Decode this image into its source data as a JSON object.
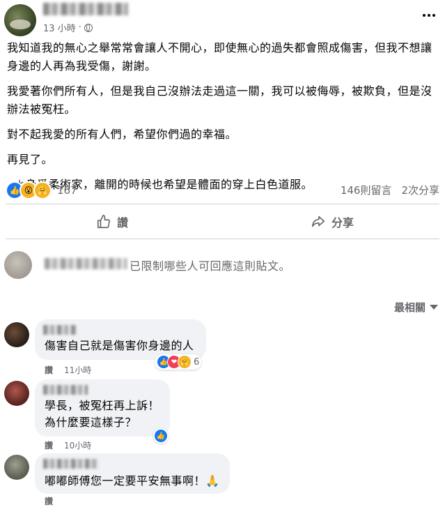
{
  "header": {
    "time": "13 小時",
    "dot": "·",
    "more_icon": "more-horizontal-icon"
  },
  "post": {
    "paragraphs": [
      "我知道我的無心之舉常常會讓人不開心，即使無心的過失都會照成傷害，但我不想讓身邊的人再為我受傷，謝謝。",
      "我愛著你們所有人，但是我自己沒辦法走過這一關，我可以被侮辱，被欺負，但是沒辦法被冤枉。",
      "對不起我愛的所有人們，希望你們過的幸福。",
      "再見了。",
      "＊身爲柔術家，離開的時候也希望是體面的穿上白色道服。"
    ]
  },
  "reactions": {
    "count": "167",
    "comments": "146則留言",
    "shares": "2次分享",
    "emoji_like": "👍",
    "emoji_wow": "😮",
    "emoji_care": "🤗"
  },
  "actions": {
    "like_label": "讚",
    "share_label": "分享"
  },
  "restriction": {
    "text": "已限制哪些人可回應這則貼文。"
  },
  "sort": {
    "label": "最相關"
  },
  "comments": [
    {
      "text": "傷害自己就是傷害你身邊的人",
      "like_label": "讚",
      "time": "11小時",
      "reaction_count": "6"
    },
    {
      "text_line1": "學長，被冤枉再上訴！",
      "text_line2": "為什麼要這樣子？",
      "like_label": "讚",
      "time": "10小時"
    },
    {
      "text": "嘟嘟師傅您一定要平安無事啊！",
      "emoji": "🙏",
      "like_label": "讚"
    }
  ]
}
